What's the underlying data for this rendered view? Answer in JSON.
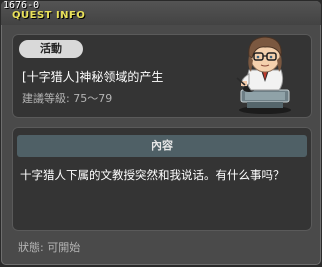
{
  "window": {
    "quest_id": "1676-0",
    "title": "QUEST INFO"
  },
  "quest": {
    "badge": "活動",
    "name": "[十字猎人]神秘领域的产生",
    "level": "建議等級: 75～79"
  },
  "content": {
    "header": "內容",
    "text": "十字猎人下属的文教授突然和我说话。有什么事吗？"
  },
  "status": "狀態: 可開始",
  "npc": {
    "icon": "professor-npc-portrait"
  }
}
